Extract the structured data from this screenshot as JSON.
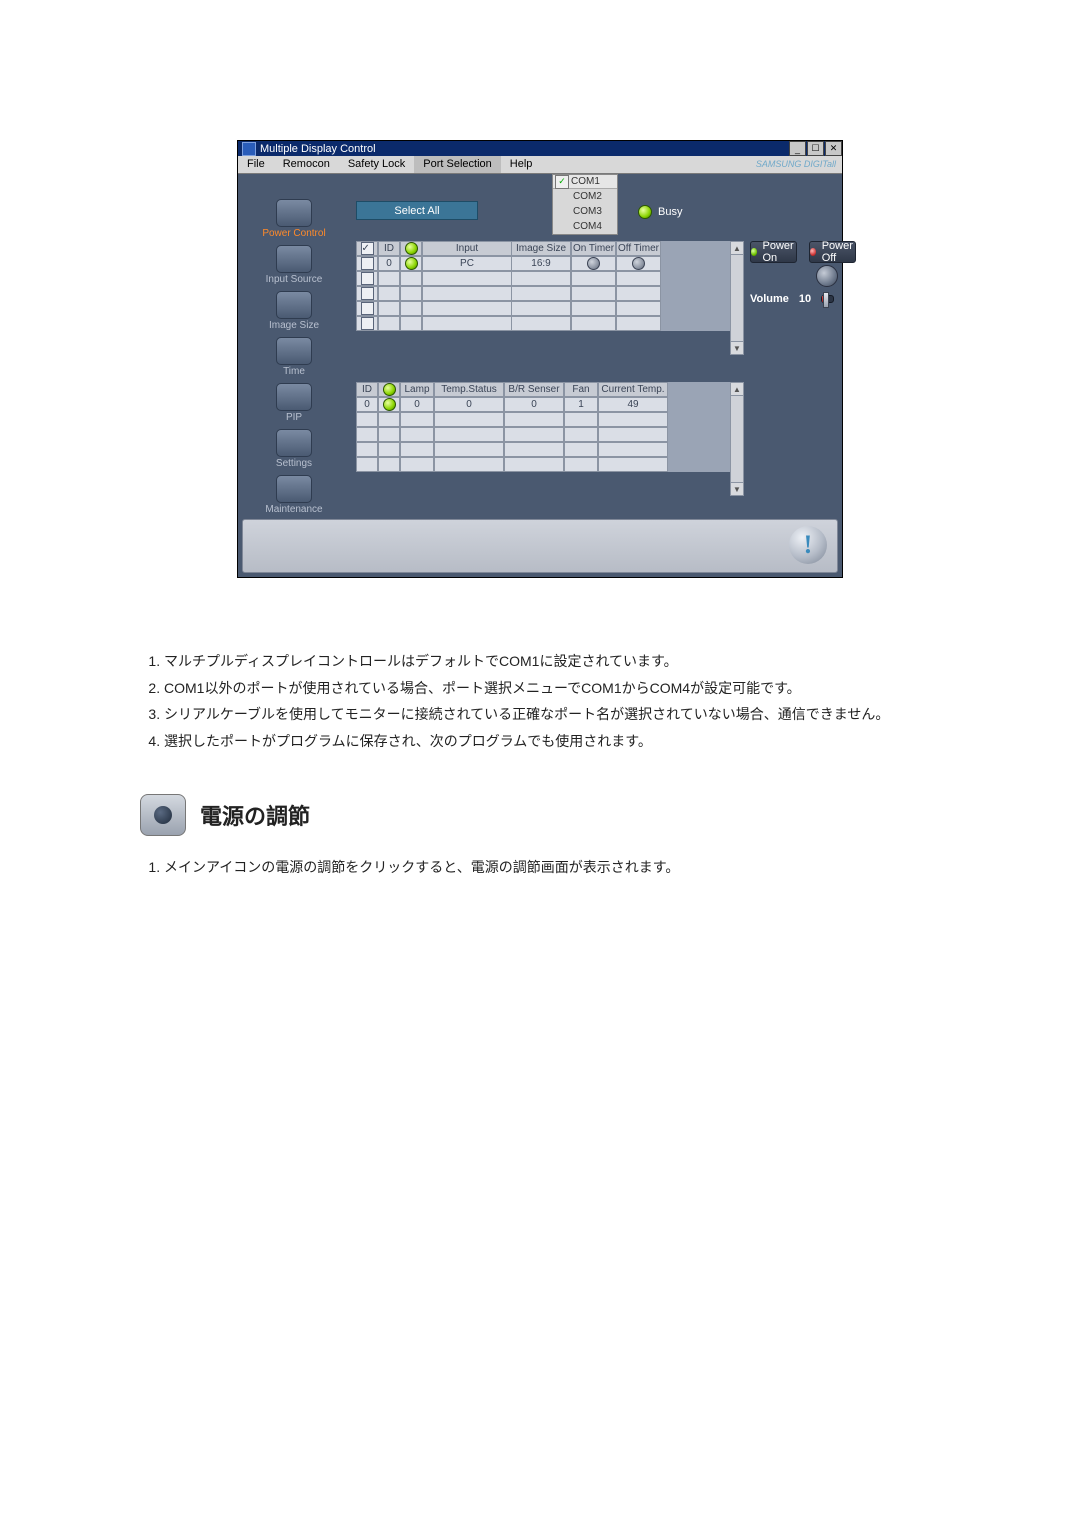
{
  "app": {
    "title": "Multiple Display Control",
    "brand": "SAMSUNG DIGITall",
    "window_buttons": {
      "min": "_",
      "max": "☐",
      "close": "✕"
    }
  },
  "menubar": [
    "File",
    "Remocon",
    "Safety Lock",
    "Port Selection",
    "Help"
  ],
  "port_dropdown": {
    "selected": "COM1",
    "options": [
      "COM1",
      "COM2",
      "COM3",
      "COM4"
    ]
  },
  "busy_label": "Busy",
  "select_all": "Select All",
  "leftnav": [
    {
      "label": "Power Control",
      "active": true
    },
    {
      "label": "Input Source",
      "active": false
    },
    {
      "label": "Image Size",
      "active": false
    },
    {
      "label": "Time",
      "active": false
    },
    {
      "label": "PIP",
      "active": false
    },
    {
      "label": "Settings",
      "active": false
    },
    {
      "label": "Maintenance",
      "active": false
    }
  ],
  "grid1": {
    "headers": {
      "chk": "",
      "id": "ID",
      "pwr": "",
      "input": "Input",
      "size": "Image Size",
      "on": "On Timer",
      "off": "Off Timer"
    },
    "rows": [
      {
        "checked": true,
        "id": "0",
        "power": "on",
        "input": "PC",
        "size": "16:9",
        "on": "○",
        "off": "○"
      },
      {
        "checked": false,
        "id": "",
        "power": "",
        "input": "",
        "size": "",
        "on": "",
        "off": ""
      },
      {
        "checked": false,
        "id": "",
        "power": "",
        "input": "",
        "size": "",
        "on": "",
        "off": ""
      },
      {
        "checked": false,
        "id": "",
        "power": "",
        "input": "",
        "size": "",
        "on": "",
        "off": ""
      },
      {
        "checked": false,
        "id": "",
        "power": "",
        "input": "",
        "size": "",
        "on": "",
        "off": ""
      }
    ]
  },
  "grid2": {
    "headers": {
      "id": "ID",
      "pwr": "",
      "lamp": "Lamp",
      "temp": "Temp.Status",
      "br": "B/R Senser",
      "fan": "Fan",
      "cur": "Current Temp."
    },
    "rows": [
      {
        "id": "0",
        "power": "on",
        "lamp": "0",
        "temp": "0",
        "br": "0",
        "fan": "1",
        "cur": "49"
      },
      {
        "id": "",
        "power": "",
        "lamp": "",
        "temp": "",
        "br": "",
        "fan": "",
        "cur": ""
      },
      {
        "id": "",
        "power": "",
        "lamp": "",
        "temp": "",
        "br": "",
        "fan": "",
        "cur": ""
      },
      {
        "id": "",
        "power": "",
        "lamp": "",
        "temp": "",
        "br": "",
        "fan": "",
        "cur": ""
      },
      {
        "id": "",
        "power": "",
        "lamp": "",
        "temp": "",
        "br": "",
        "fan": "",
        "cur": ""
      }
    ]
  },
  "right_panel": {
    "power_on": "Power On",
    "power_off": "Power Off",
    "volume_label": "Volume",
    "volume_value": "10"
  },
  "doc": {
    "notes": [
      "マルチプルディスプレイコントロールはデフォルトでCOM1に設定されています。",
      "COM1以外のポートが使用されている場合、ポート選択メニューでCOM1からCOM4が設定可能です。",
      "シリアルケーブルを使用してモニターに接続されている正確なポート名が選択されていない場合、通信できません。",
      "選択したポートがプログラムに保存され、次のプログラムでも使用されます。"
    ],
    "section_title": "電源の調節",
    "notes2": [
      "メインアイコンの電源の調節をクリックすると、電源の調節画面が表示されます。"
    ]
  }
}
